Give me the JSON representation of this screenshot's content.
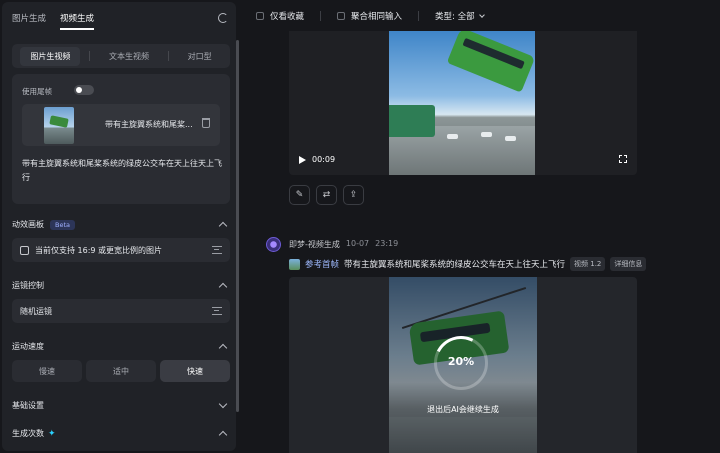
{
  "left_panel": {
    "top_tabs": [
      "图片生成",
      "视频生成"
    ],
    "active_top_tab": "视频生成",
    "sub_tabs": [
      "图片生视频",
      "文本生视频",
      "对口型"
    ],
    "active_sub_tab": "图片生视频",
    "first_frame_label": "使用尾帧",
    "first_frame_toggle_on": false,
    "frame_name": "带有主旋翼系统和尾桨...",
    "prompt": "带有主旋翼系统和尾桨系统的绿皮公交车在天上往天上飞行",
    "motion_canvas": {
      "title": "动效画板",
      "badge": "Beta",
      "note": "当前仅支持 16:9 或更宽比例的图片"
    },
    "camera": {
      "title": "运镜控制",
      "value": "随机运镜"
    },
    "speed": {
      "title": "运动速度",
      "options": [
        "慢速",
        "适中",
        "快速"
      ],
      "active": "快速"
    },
    "basic_settings": "基础设置",
    "gen_count": {
      "title": "生成次数",
      "sparkle": "✦"
    }
  },
  "toolbar": {
    "favorites_only": "仅看收藏",
    "aggregate_input": "聚合相同输入",
    "type_filter": "类型: 全部"
  },
  "video1": {
    "time": "00:09"
  },
  "result": {
    "author": "即梦-视频生成",
    "date": "10-07",
    "time": "23:19",
    "ref_label": "参考首帧",
    "prompt": "带有主旋翼系统和尾桨系统的绿皮公交车在天上往天上飞行",
    "version": "视频 1.2",
    "details": "详细信息"
  },
  "video2": {
    "progress_percent": "20%",
    "progress_value": 0.2,
    "hint": "退出后AI会继续生成"
  },
  "colors": {
    "accent": "#9fbaff",
    "bg": "#16171b",
    "panel": "#202227",
    "bus_green": "#3b9a3f"
  }
}
